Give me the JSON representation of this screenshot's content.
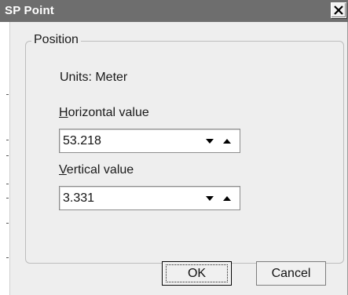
{
  "window": {
    "title": "SP Point",
    "close_icon": "close-icon"
  },
  "group": {
    "legend": "Position",
    "units_text": "Units: Meter"
  },
  "horizontal": {
    "label_first": "H",
    "label_rest": "orizontal value",
    "value": "53.218"
  },
  "vertical": {
    "label_first": "V",
    "label_rest": "ertical value",
    "value": "3.331"
  },
  "buttons": {
    "ok": "OK",
    "cancel": "Cancel"
  },
  "colors": {
    "titlebar": "#6e6e6e",
    "dialog_bg": "#eeeeee"
  }
}
